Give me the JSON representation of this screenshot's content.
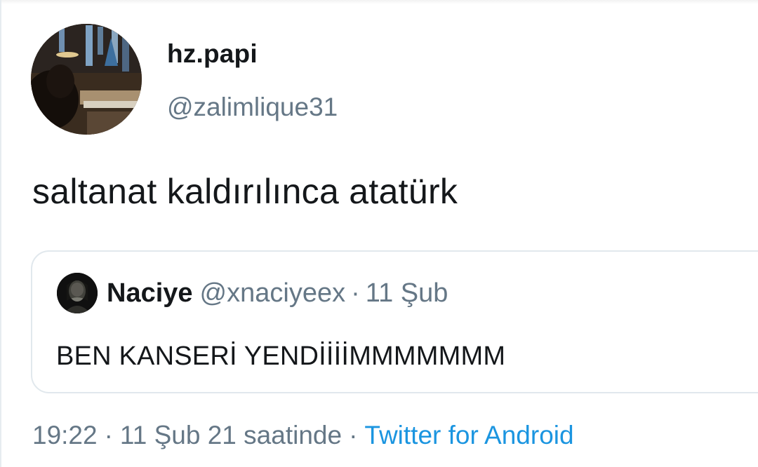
{
  "tweet": {
    "author": {
      "display_name": "hz.papi",
      "username": "@zalimlique31",
      "avatar_icon": "profile-photo-church-interior"
    },
    "text": "saltanat kaldırılınca atatürk",
    "quoted_tweet": {
      "display_name": "Naciye",
      "username": "@xnaciyeex",
      "separator": "·",
      "time": "11 Şub",
      "text": "BEN KANSERİ YENDİİİİMMMMMMM",
      "avatar_icon": "profile-photo-dark-portrait"
    },
    "meta": {
      "time": "19:22",
      "separator": "·",
      "date": "11 Şub 21 saatinde",
      "source": "Twitter for Android"
    }
  },
  "colors": {
    "primary_text": "#14171a",
    "secondary_text": "#657786",
    "link": "#1b95e0",
    "border": "#e1e8ed"
  }
}
